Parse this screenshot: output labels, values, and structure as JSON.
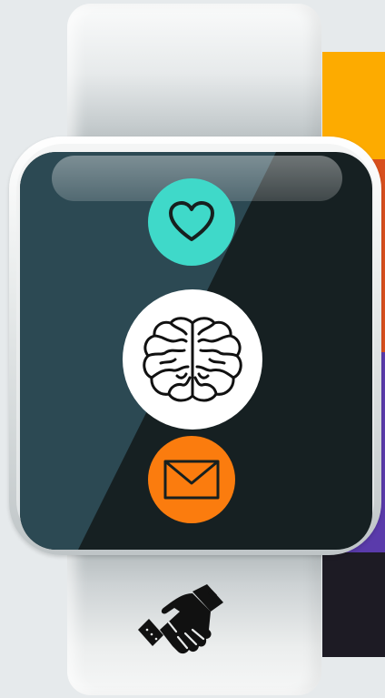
{
  "colors": {
    "background": "#e6eaec",
    "panel_yellow": "#fdab00",
    "panel_red": "#d8501e",
    "panel_purple": "#5a3bab",
    "panel_dark": "#1d1b24",
    "screen": "#162022",
    "screen_highlight": "#2c4953",
    "heart_app": "#3fd9c9",
    "brain_app": "#ffffff",
    "mail_app": "#fb7c0e"
  },
  "watch": {
    "apps": [
      {
        "name": "heart",
        "icon": "heart-icon"
      },
      {
        "name": "brain",
        "icon": "brain-icon"
      },
      {
        "name": "mail",
        "icon": "envelope-icon"
      }
    ],
    "band_icon": "handshake-icon"
  }
}
